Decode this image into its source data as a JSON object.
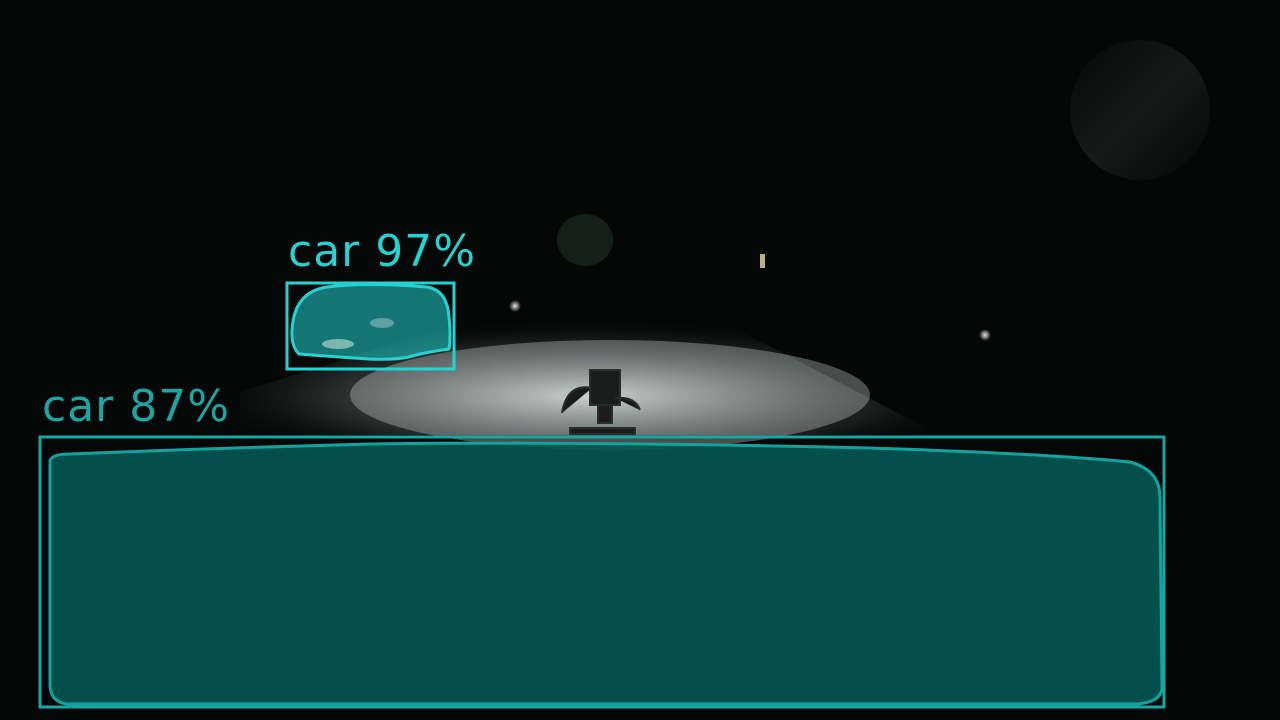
{
  "detections": [
    {
      "label": "car",
      "score_text": "97%",
      "confidence": 0.97,
      "color": "#22d3d1"
    },
    {
      "label": "car",
      "score_text": "87%",
      "confidence": 0.87,
      "color": "#18a7a3"
    }
  ]
}
